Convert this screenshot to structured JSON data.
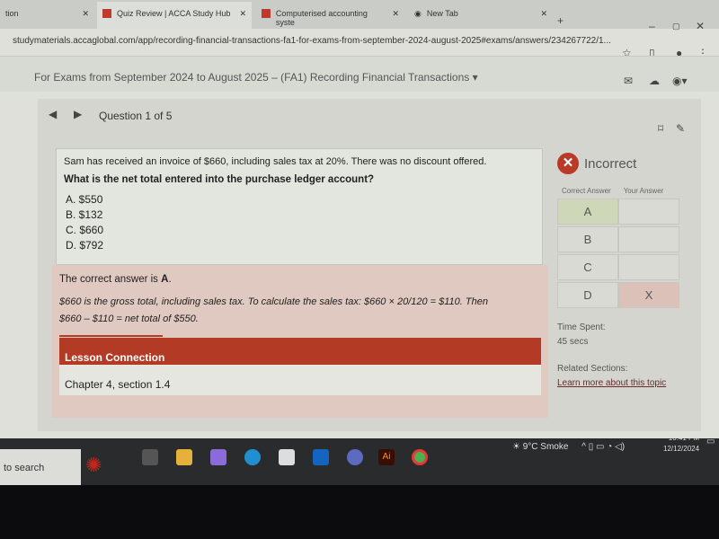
{
  "browser": {
    "tabs": [
      {
        "label": "tion"
      },
      {
        "label": "Quiz Review | ACCA Study Hub",
        "active": true
      },
      {
        "label": "Computerised accounting syste"
      },
      {
        "label": "New Tab"
      }
    ],
    "url": "studymaterials.accaglobal.com/app/recording-financial-transactions-fa1-for-exams-from-september-2024-august-2025#exams/answers/234267722/1..."
  },
  "header": {
    "course": "For Exams from September 2024 to August 2025 – (FA1) Recording Financial Transactions ▾"
  },
  "quiz": {
    "position": "Question 1 of 5",
    "stem": "Sam has received an invoice of $660, including sales tax at 20%. There was no discount offered.",
    "question": "What is the net total entered into the purchase ledger account?",
    "options": [
      "A. $550",
      "B. $132",
      "C. $660",
      "D. $792"
    ],
    "correct_prefix": "The correct answer is ",
    "correct_letter": "A",
    "explanation_1": "$660 is the gross total, including sales tax. To calculate the sales tax: $660 × 20/120 = $110. Then",
    "explanation_2": "$660 – $110 = net total of $550.",
    "lesson_title": "Lesson Connection",
    "lesson_ref": "Chapter 4, section 1.4"
  },
  "result": {
    "status": "Incorrect",
    "col_correct": "Correct Answer",
    "col_yours": "Your Answer",
    "rows": [
      {
        "letter": "A",
        "mine": ""
      },
      {
        "letter": "B",
        "mine": ""
      },
      {
        "letter": "C",
        "mine": ""
      },
      {
        "letter": "D",
        "mine": "X"
      }
    ],
    "time_label": "Time Spent:",
    "time_value": "45 secs",
    "related_label": "Related Sections:",
    "related_link": "Learn more about this topic",
    "accent": "#b83a27"
  },
  "taskbar": {
    "search": "to search",
    "weather": "9°C  Smoke",
    "time": "10:41 PM",
    "date": "12/12/2024",
    "ai_label": "Ai"
  }
}
